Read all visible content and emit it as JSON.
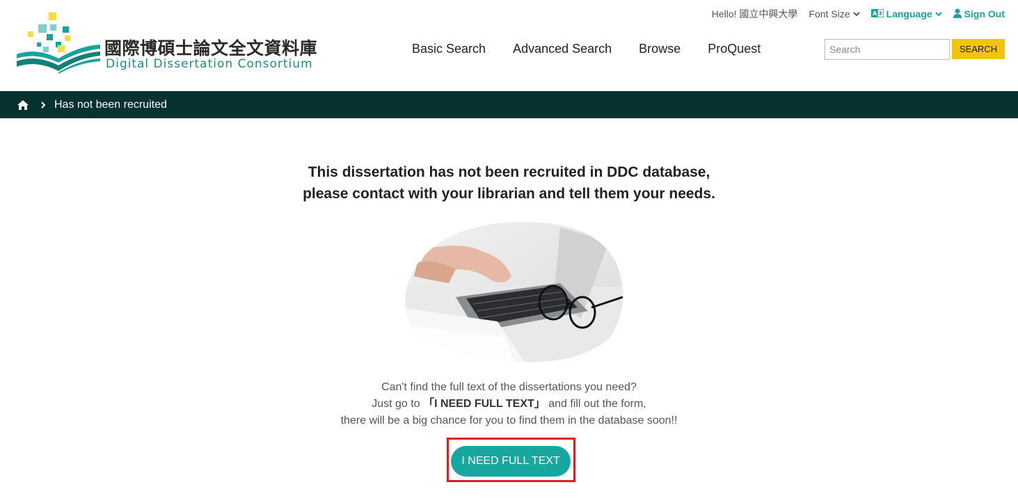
{
  "header": {
    "logo_zh": "國際博碩士論文全文資料庫",
    "logo_en": "Digital Dissertation Consortium",
    "greeting": "Hello! 國立中興大學",
    "font_size_label": "Font Size",
    "language_label": "Language",
    "signout_label": "Sign Out",
    "nav": [
      "Basic Search",
      "Advanced Search",
      "Browse",
      "ProQuest"
    ],
    "search_placeholder": "Search",
    "search_button": "SEARCH"
  },
  "breadcrumb": {
    "current": "Has not been recruited"
  },
  "main": {
    "headline_line1": "This dissertation has not been recruited in DDC database,",
    "headline_line2": "please contact with your librarian and tell them your needs.",
    "info_line1": "Can't find the full text of the dissertations you need?",
    "info_line2_prefix": "Just go to ",
    "info_line2_highlight": "「I NEED FULL TEXT」",
    "info_line2_suffix": " and fill out the form,",
    "info_line3": "there will be a big chance for you to find them in the database soon!!",
    "cta_label": "I NEED FULL TEXT"
  },
  "colors": {
    "teal": "#18a79e",
    "dark_bar": "#063232",
    "search_button": "#f2c30f",
    "highlight_border": "#e11b22"
  }
}
